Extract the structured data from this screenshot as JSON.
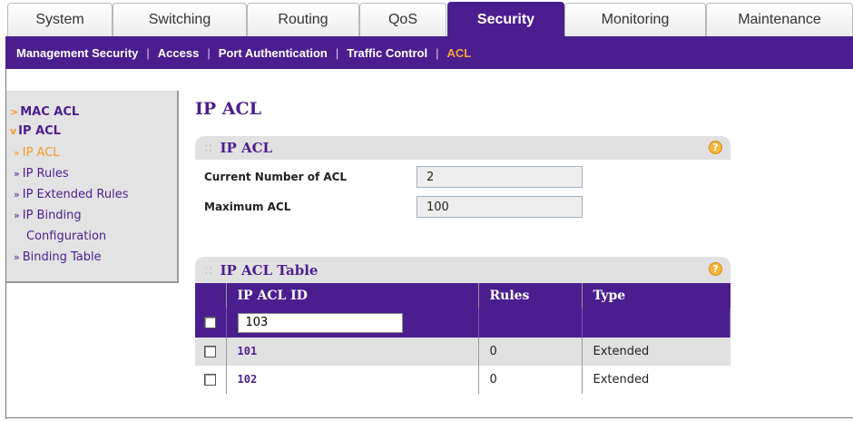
{
  "tabs": [
    {
      "label": "System"
    },
    {
      "label": "Switching"
    },
    {
      "label": "Routing"
    },
    {
      "label": "QoS"
    },
    {
      "label": "Security"
    },
    {
      "label": "Monitoring"
    },
    {
      "label": "Maintenance"
    }
  ],
  "subnav": {
    "items": [
      "Management Security",
      "Access",
      "Port Authentication",
      "Traffic Control",
      "ACL"
    ],
    "separator": "|"
  },
  "sidebar": {
    "mac_acl": "MAC ACL",
    "ip_acl": "IP ACL",
    "items": [
      "IP ACL",
      "IP Rules",
      "IP Extended Rules",
      "IP Binding",
      "Configuration",
      "Binding Table"
    ]
  },
  "page_title": "IP ACL",
  "ip_acl_panel": {
    "title": "IP ACL",
    "current_label": "Current Number of ACL",
    "current_value": "2",
    "max_label": "Maximum ACL",
    "max_value": "100"
  },
  "table_panel": {
    "title": "IP ACL Table",
    "columns": [
      "IP ACL ID",
      "Rules",
      "Type"
    ],
    "new_id_value": "103",
    "rows": [
      {
        "id": "101",
        "rules": "0",
        "type": "Extended"
      },
      {
        "id": "102",
        "rules": "0",
        "type": "Extended"
      }
    ]
  },
  "help_glyph": "?",
  "colors": {
    "brand_purple": "#4b1e8f",
    "accent_orange": "#f39a22",
    "panel_gray": "#e1e1e1"
  }
}
